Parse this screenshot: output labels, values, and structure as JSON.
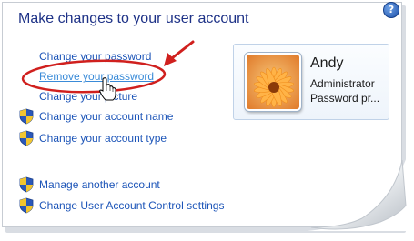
{
  "page": {
    "title": "Make changes to your user account",
    "help_glyph": "?"
  },
  "tasks": [
    {
      "label": "Change your password",
      "shield": false
    },
    {
      "label": "Remove your password",
      "shield": false
    },
    {
      "label": "Change your picture",
      "shield": false
    },
    {
      "label": "Change your account name",
      "shield": true
    },
    {
      "label": "Change your account type",
      "shield": true
    },
    {
      "label": "Manage another account",
      "shield": true
    },
    {
      "label": "Change User Account Control settings",
      "shield": true
    }
  ],
  "user": {
    "name": "Andy",
    "role": "Administrator",
    "status": "Password pr..."
  },
  "colors": {
    "title": "#1e3287",
    "link": "#1d55b8",
    "link_hover": "#3a8bd8",
    "annotation": "#d0201e"
  },
  "icons": [
    "uac-shield-icon",
    "help-icon",
    "hand-cursor-icon",
    "red-arrow",
    "red-ellipse"
  ]
}
